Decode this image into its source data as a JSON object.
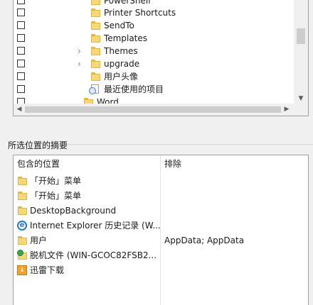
{
  "tree": {
    "items": [
      {
        "label": "PowerShell",
        "icon": "folder-icon",
        "expandable": false
      },
      {
        "label": "Printer Shortcuts",
        "icon": "folder-icon",
        "expandable": false
      },
      {
        "label": "SendTo",
        "icon": "folder-icon",
        "expandable": false
      },
      {
        "label": "Templates",
        "icon": "folder-icon",
        "expandable": false
      },
      {
        "label": "Themes",
        "icon": "folder-icon",
        "expandable": true
      },
      {
        "label": "upgrade",
        "icon": "folder-icon",
        "expandable": true
      },
      {
        "label": "用户头像",
        "icon": "folder-icon",
        "expandable": false
      },
      {
        "label": "最近使用的项目",
        "icon": "recent-items-icon",
        "expandable": false
      },
      {
        "label": "Word",
        "icon": "folder-icon",
        "expandable": false
      }
    ]
  },
  "summary": {
    "title": "所选位置的摘要",
    "columns": {
      "included": "包含的位置",
      "excluded": "排除"
    },
    "rows": [
      {
        "location": "「开始」菜单",
        "excluded": "",
        "icon": "folder-icon"
      },
      {
        "location": "「开始」菜单",
        "excluded": "",
        "icon": "folder-icon"
      },
      {
        "location": "DesktopBackground",
        "excluded": "",
        "icon": "folder-icon"
      },
      {
        "location": "Internet Explorer 历史记录 (W...",
        "excluded": "",
        "icon": "internet-explorer-icon"
      },
      {
        "location": "用户",
        "excluded": "AppData; AppData",
        "icon": "folder-icon"
      },
      {
        "location": "脱机文件 (WIN-GCOC82FSB2...",
        "excluded": "",
        "icon": "offline-files-icon"
      },
      {
        "location": "迅雷下载",
        "excluded": "",
        "icon": "xunlei-icon"
      }
    ]
  }
}
